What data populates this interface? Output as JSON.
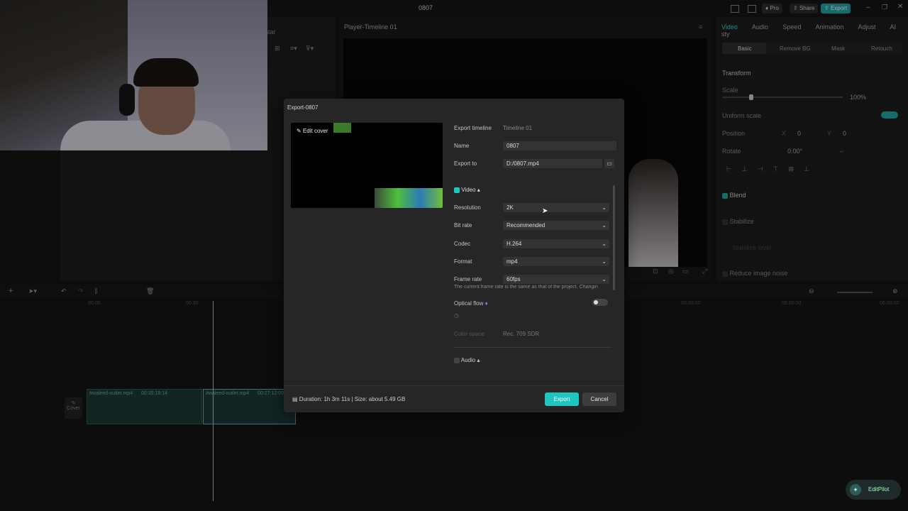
{
  "window": {
    "title": "0807",
    "pro_label": "Pro",
    "share_label": "Share",
    "export_label": "Export"
  },
  "player": {
    "title": "Player-Timeline 01",
    "avatar_label": "atar"
  },
  "right_panel": {
    "tabs": [
      "Video",
      "Audio",
      "Speed",
      "Animation",
      "Adjust",
      "AI sty"
    ],
    "subtabs": [
      "Basic",
      "Remove BG",
      "Mask",
      "Retouch"
    ],
    "transform_label": "Transform",
    "scale_label": "Scale",
    "scale_value": "100%",
    "uniform_scale_label": "Uniform scale",
    "position_label": "Position",
    "pos_x_label": "X",
    "pos_x": "0",
    "pos_y_label": "Y",
    "pos_y": "0",
    "rotate_label": "Rotate",
    "rotate_value": "0.00°",
    "rotate_dash": "–",
    "blend_label": "Blend",
    "stabilize_label": "Stabilize",
    "stabilize_level": "Stabilize level",
    "reduce_noise_label": "Reduce image noise"
  },
  "timeline": {
    "times": [
      "00:00",
      "00:30",
      "03:00:00",
      "05:00:00",
      "06:00:00"
    ],
    "cover_label": "Cover",
    "clips": [
      {
        "name": "#waleed-outlet.mp4",
        "duration": "00:35:18:14"
      },
      {
        "name": "#waleed-outlet.mp4",
        "duration": "00:27:12:09"
      }
    ]
  },
  "export_dialog": {
    "title": "Export-0807",
    "edit_cover": "Edit cover",
    "export_timeline_label": "Export timeline",
    "export_timeline_value": "Timeline 01",
    "name_label": "Name",
    "name_value": "0807",
    "export_to_label": "Export to",
    "export_to_value": "D:/0807.mp4",
    "video_label": "Video",
    "resolution_label": "Resolution",
    "resolution_value": "2K",
    "bitrate_label": "Bit rate",
    "bitrate_value": "Recommended",
    "codec_label": "Codec",
    "codec_value": "H.264",
    "format_label": "Format",
    "format_value": "mp4",
    "framerate_label": "Frame rate",
    "framerate_value": "60fps",
    "framerate_note": "The current frame rate is the same as that of the project. Changin",
    "optical_flow_label": "Optical flow",
    "color_space_label": "Color space",
    "color_space_value": "Rec. 709 SDR",
    "audio_label": "Audio",
    "duration_info": "Duration: 1h 3m 11s | Size: about 5.49 GB",
    "export_button": "Export",
    "cancel_button": "Cancel"
  },
  "editpilot": {
    "label": "EditPilot"
  },
  "colors": {
    "accent": "#1fc5c1",
    "dialog_bg": "#262626",
    "app_bg": "#151515"
  }
}
